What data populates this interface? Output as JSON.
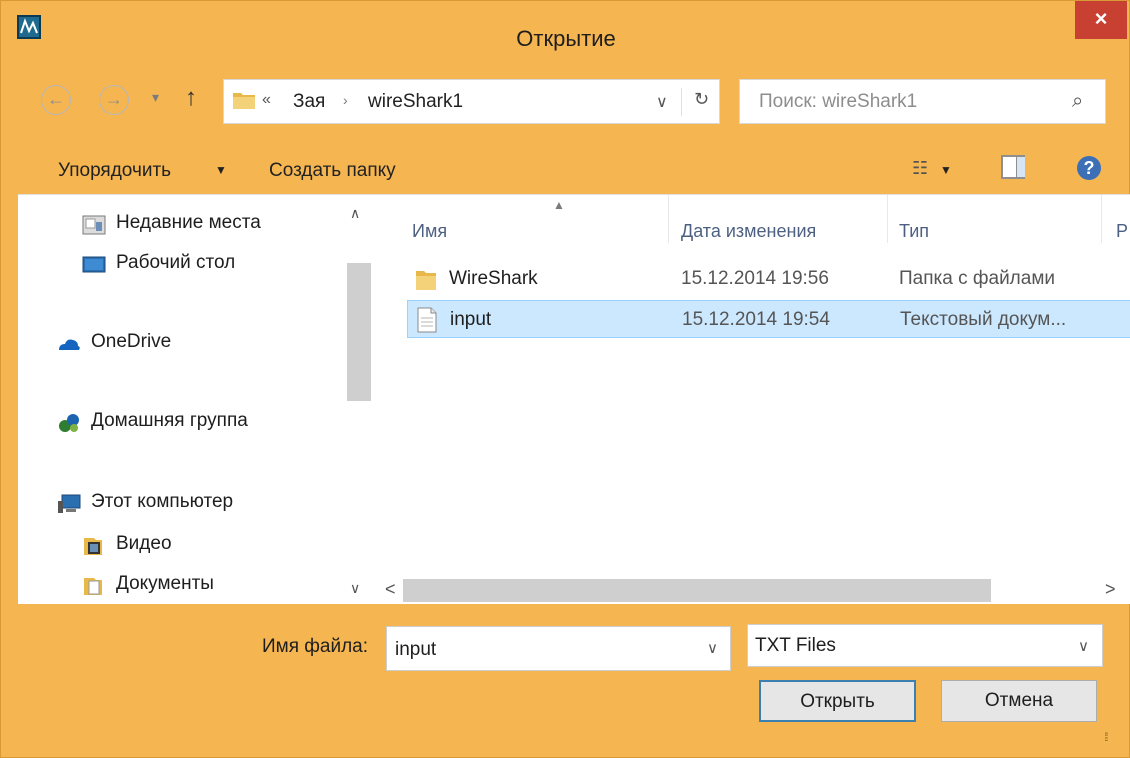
{
  "window": {
    "title": "Открытие",
    "close_glyph": "×",
    "accent_color": "#f5b550",
    "close_color": "#c84031"
  },
  "nav": {
    "back_glyph": "←",
    "forward_glyph": "→",
    "up_glyph": "↑",
    "history_glyph": "▾"
  },
  "address": {
    "overflow_glyph": "«",
    "crumbs": [
      "Зая",
      "wireShark1"
    ],
    "separator_glyph": "›",
    "dropdown_glyph": "∨",
    "refresh_glyph": "↻"
  },
  "search": {
    "placeholder": "Поиск: wireShark1",
    "icon_glyph": "⌕"
  },
  "toolbar": {
    "organize_label": "Упорядочить",
    "organize_caret": "▼",
    "new_folder_label": "Создать папку",
    "view_glyph": "☷",
    "view_caret": "▼",
    "help_glyph": "?"
  },
  "sidebar": {
    "items": [
      {
        "label": "Недавние места",
        "icon": "recent-places-icon"
      },
      {
        "label": "Рабочий стол",
        "icon": "desktop-icon"
      },
      {
        "label": "OneDrive",
        "icon": "onedrive-icon"
      },
      {
        "label": "Домашняя группа",
        "icon": "homegroup-icon"
      },
      {
        "label": "Этот компьютер",
        "icon": "computer-icon"
      },
      {
        "label": "Видео",
        "icon": "videos-folder-icon"
      },
      {
        "label": "Документы",
        "icon": "documents-folder-icon"
      }
    ],
    "scroll_up_glyph": "∧",
    "scroll_down_glyph": "∨"
  },
  "files": {
    "columns": [
      "Имя",
      "Дата изменения",
      "Тип",
      "Р"
    ],
    "sort_glyph": "▲",
    "rows": [
      {
        "name": "WireShark",
        "date": "15.12.2014 19:56",
        "type": "Папка с файлами",
        "kind": "folder"
      },
      {
        "name": "input",
        "date": "15.12.2014 19:54",
        "type": "Текстовый докум...",
        "kind": "text-file",
        "selected": true
      }
    ],
    "scroll_left_glyph": "<",
    "scroll_right_glyph": ">"
  },
  "bottom": {
    "filename_label": "Имя файла:",
    "filename_value": "input",
    "filename_arrow": "∨",
    "filetype_value": "TXT Files",
    "filetype_arrow": "∨",
    "open_label": "Открыть",
    "cancel_label": "Отмена",
    "grip_glyph": "⁞⁞"
  }
}
